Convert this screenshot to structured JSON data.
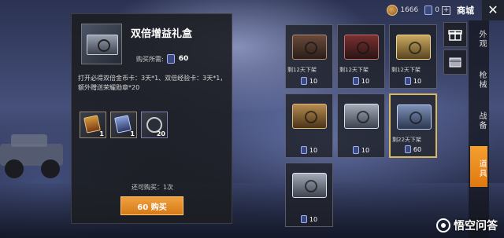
{
  "topbar": {
    "coin_amount": "1666",
    "card_amount": "0",
    "plus": "+",
    "shop_label": "商城",
    "close": "✕"
  },
  "detail": {
    "title": "双倍增益礼盒",
    "price_label": "购买所需:",
    "price_value": "60",
    "description": "打开必得双倍金币卡：3天*1、双倍经验卡：3天*1，额外赠送荣耀勋章*20",
    "rewards": [
      {
        "qty": "1",
        "badge": "3天"
      },
      {
        "qty": "1",
        "badge": "3天"
      },
      {
        "qty": "20",
        "badge": ""
      }
    ],
    "remaining": "还可购买：1次",
    "buy_label": "60 购买"
  },
  "items": [
    {
      "tag": "剩12天下架",
      "cost": "10"
    },
    {
      "tag": "剩12天下架",
      "cost": "10"
    },
    {
      "tag": "剩12天下架",
      "cost": "10"
    },
    {
      "tag": "",
      "cost": "10"
    },
    {
      "tag": "",
      "cost": "10"
    },
    {
      "tag": "剩22天下架",
      "cost": "60"
    },
    {
      "tag": "",
      "cost": "10"
    }
  ],
  "tabs": {
    "appearance": "外观",
    "weapons": "枪械",
    "battle": "战备",
    "props": "道具"
  },
  "watermark": "悟空问答",
  "colors": {
    "accent": "#e8891c",
    "selected_border": "#d8b860"
  }
}
